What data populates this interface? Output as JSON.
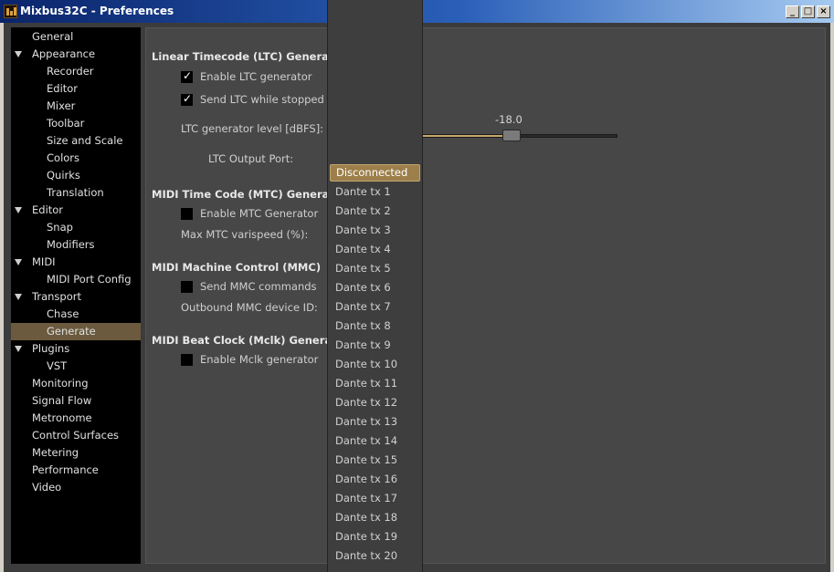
{
  "window": {
    "title": "Mixbus32C - Preferences"
  },
  "sidebar": {
    "items": [
      {
        "label": "General",
        "level": 1,
        "expanded": false,
        "selected": false
      },
      {
        "label": "Appearance",
        "level": 1,
        "expanded": true,
        "selected": false
      },
      {
        "label": "Recorder",
        "level": 2,
        "selected": false
      },
      {
        "label": "Editor",
        "level": 2,
        "selected": false
      },
      {
        "label": "Mixer",
        "level": 2,
        "selected": false
      },
      {
        "label": "Toolbar",
        "level": 2,
        "selected": false
      },
      {
        "label": "Size and Scale",
        "level": 2,
        "selected": false
      },
      {
        "label": "Colors",
        "level": 2,
        "selected": false
      },
      {
        "label": "Quirks",
        "level": 2,
        "selected": false
      },
      {
        "label": "Translation",
        "level": 2,
        "selected": false
      },
      {
        "label": "Editor",
        "level": 1,
        "expanded": true,
        "selected": false
      },
      {
        "label": "Snap",
        "level": 2,
        "selected": false
      },
      {
        "label": "Modifiers",
        "level": 2,
        "selected": false
      },
      {
        "label": "MIDI",
        "level": 1,
        "expanded": true,
        "selected": false
      },
      {
        "label": "MIDI Port Config",
        "level": 2,
        "selected": false
      },
      {
        "label": "Transport",
        "level": 1,
        "expanded": true,
        "selected": false
      },
      {
        "label": "Chase",
        "level": 2,
        "selected": false
      },
      {
        "label": "Generate",
        "level": 2,
        "selected": true
      },
      {
        "label": "Plugins",
        "level": 1,
        "expanded": true,
        "selected": false
      },
      {
        "label": "VST",
        "level": 2,
        "selected": false
      },
      {
        "label": "Monitoring",
        "level": 1,
        "expanded": false,
        "selected": false
      },
      {
        "label": "Signal Flow",
        "level": 1,
        "expanded": false,
        "selected": false
      },
      {
        "label": "Metronome",
        "level": 1,
        "expanded": false,
        "selected": false
      },
      {
        "label": "Control Surfaces",
        "level": 1,
        "expanded": false,
        "selected": false
      },
      {
        "label": "Metering",
        "level": 1,
        "expanded": false,
        "selected": false
      },
      {
        "label": "Performance",
        "level": 1,
        "expanded": false,
        "selected": false
      },
      {
        "label": "Video",
        "level": 1,
        "expanded": false,
        "selected": false
      }
    ]
  },
  "ltc": {
    "title": "Linear Timecode (LTC) Genera",
    "enable_label": "Enable LTC generator",
    "enable_checked": true,
    "send_stopped_label": "Send LTC while stopped",
    "send_stopped_checked": true,
    "level_label": "LTC generator level [dBFS]:",
    "level_value_text": "-18.0",
    "level_fraction": 0.46,
    "output_port_label": "LTC Output Port:"
  },
  "mtc": {
    "title": "MIDI Time Code (MTC) Genera",
    "enable_label": "Enable MTC Generator",
    "enable_checked": false,
    "varispeed_label": "Max MTC varispeed (%):"
  },
  "mmc": {
    "title": "MIDI Machine Control (MMC)",
    "send_label": "Send MMC commands",
    "send_checked": false,
    "device_id_label": "Outbound MMC device ID:"
  },
  "mclk": {
    "title": "MIDI Beat Clock (Mclk) Genera",
    "enable_label": "Enable Mclk generator",
    "enable_checked": false
  },
  "dropdown": {
    "selected": "Disconnected",
    "options": [
      "Disconnected",
      "Dante tx 1",
      "Dante tx 2",
      "Dante tx 3",
      "Dante tx 4",
      "Dante tx 5",
      "Dante tx 6",
      "Dante tx 7",
      "Dante tx 8",
      "Dante tx 9",
      "Dante tx 10",
      "Dante tx 11",
      "Dante tx 12",
      "Dante tx 13",
      "Dante tx 14",
      "Dante tx 15",
      "Dante tx 16",
      "Dante tx 17",
      "Dante tx 18",
      "Dante tx 19",
      "Dante tx 20"
    ]
  },
  "colors": {
    "selection": "#6b5a3e",
    "accent": "#9c7f4a",
    "slider_fill": "#c9a86a"
  }
}
